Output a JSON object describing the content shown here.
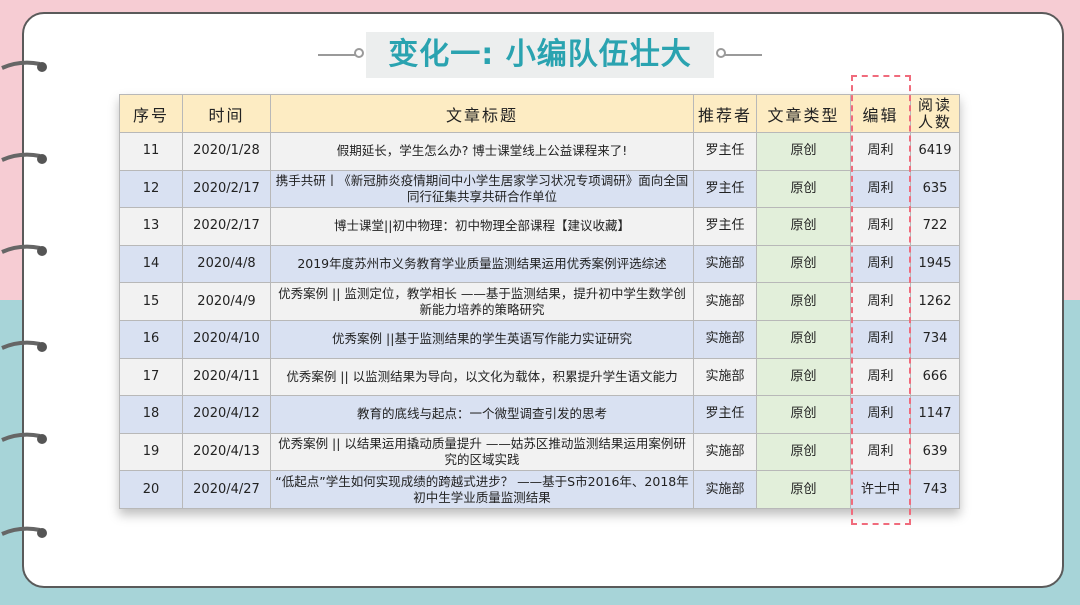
{
  "slide": {
    "title": "变化一: 小编队伍壮大"
  },
  "table": {
    "headers": {
      "index": "序号",
      "time": "时间",
      "title": "文章标题",
      "recommender": "推荐者",
      "type": "文章类型",
      "editor": "编辑",
      "reads": "阅读人数"
    },
    "rows": [
      {
        "index": "11",
        "time": "2020/1/28",
        "title": "假期延长，学生怎么办? 博士课堂线上公益课程来了!",
        "recommender": "罗主任",
        "type": "原创",
        "editor": "周利",
        "reads": "6419"
      },
      {
        "index": "12",
        "time": "2020/2/17",
        "title": "携手共研丨《新冠肺炎疫情期间中小学生居家学习状况专项调研》面向全国同行征集共享共研合作单位",
        "recommender": "罗主任",
        "type": "原创",
        "editor": "周利",
        "reads": "635"
      },
      {
        "index": "13",
        "time": "2020/2/17",
        "title": "博士课堂||初中物理：初中物理全部课程【建议收藏】",
        "recommender": "罗主任",
        "type": "原创",
        "editor": "周利",
        "reads": "722"
      },
      {
        "index": "14",
        "time": "2020/4/8",
        "title": "2019年度苏州市义务教育学业质量监测结果运用优秀案例评选综述",
        "recommender": "实施部",
        "type": "原创",
        "editor": "周利",
        "reads": "1945"
      },
      {
        "index": "15",
        "time": "2020/4/9",
        "title": "优秀案例 || 监测定位，教学相长 ——基于监测结果，提升初中学生数学创新能力培养的策略研究",
        "recommender": "实施部",
        "type": "原创",
        "editor": "周利",
        "reads": "1262"
      },
      {
        "index": "16",
        "time": "2020/4/10",
        "title": "优秀案例 ||基于监测结果的学生英语写作能力实证研究",
        "recommender": "实施部",
        "type": "原创",
        "editor": "周利",
        "reads": "734"
      },
      {
        "index": "17",
        "time": "2020/4/11",
        "title": "优秀案例 || 以监测结果为导向，以文化为载体，积累提升学生语文能力",
        "recommender": "实施部",
        "type": "原创",
        "editor": "周利",
        "reads": "666"
      },
      {
        "index": "18",
        "time": "2020/4/12",
        "title": "教育的底线与起点：一个微型调查引发的思考",
        "recommender": "罗主任",
        "type": "原创",
        "editor": "周利",
        "reads": "1147"
      },
      {
        "index": "19",
        "time": "2020/4/13",
        "title": "优秀案例 || 以结果运用撬动质量提升 ——姑苏区推动监测结果运用案例研究的区域实践",
        "recommender": "实施部",
        "type": "原创",
        "editor": "周利",
        "reads": "639"
      },
      {
        "index": "20",
        "time": "2020/4/27",
        "title": "“低起点”学生如何实现成绩的跨越式进步？ ——基于S市2016年、2018年初中生学业质量监测结果",
        "recommender": "实施部",
        "type": "原创",
        "editor": "许士中",
        "reads": "743"
      }
    ]
  },
  "colors": {
    "title": "#2aa3b0",
    "header_bg": "#fdecc3",
    "row_odd": "#f2f2f2",
    "row_even": "#d9e1f2",
    "type_col": "#e2efda",
    "highlight_dash": "#f06b7c",
    "bg_top": "#f6ccd3",
    "bg_bottom": "#a7d4d8"
  }
}
